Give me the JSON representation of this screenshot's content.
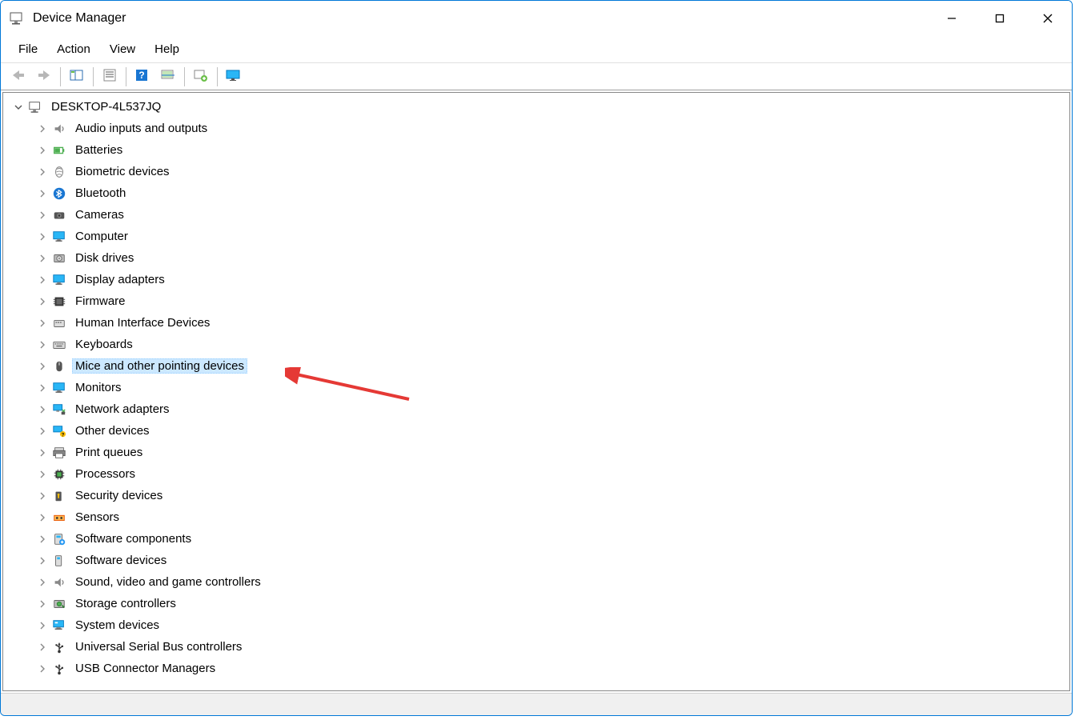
{
  "window": {
    "title": "Device Manager"
  },
  "menubar": {
    "items": [
      {
        "label": "File"
      },
      {
        "label": "Action"
      },
      {
        "label": "View"
      },
      {
        "label": "Help"
      }
    ]
  },
  "toolbar": {
    "buttons": [
      {
        "name": "back-button",
        "icon": "arrow-left-icon",
        "enabled": false
      },
      {
        "name": "forward-button",
        "icon": "arrow-right-icon",
        "enabled": false
      },
      {
        "sep": true
      },
      {
        "name": "show-hidden-button",
        "icon": "panel-icon"
      },
      {
        "sep": true
      },
      {
        "name": "properties-button",
        "icon": "properties-icon"
      },
      {
        "sep": true
      },
      {
        "name": "help-button",
        "icon": "help-icon"
      },
      {
        "name": "scan-hardware-button",
        "icon": "scan-icon"
      },
      {
        "sep": true
      },
      {
        "name": "add-legacy-button",
        "icon": "add-icon"
      },
      {
        "sep": true
      },
      {
        "name": "monitor-button",
        "icon": "monitor-icon"
      }
    ]
  },
  "tree": {
    "root_label": "DESKTOP-4L537JQ",
    "selected_index": 12,
    "categories": [
      {
        "label": "Audio inputs and outputs",
        "icon": "audio-icon"
      },
      {
        "label": "Batteries",
        "icon": "battery-icon"
      },
      {
        "label": "Biometric devices",
        "icon": "biometric-icon"
      },
      {
        "label": "Bluetooth",
        "icon": "bluetooth-icon"
      },
      {
        "label": "Cameras",
        "icon": "camera-icon"
      },
      {
        "label": "Computer",
        "icon": "computer-icon"
      },
      {
        "label": "Disk drives",
        "icon": "disk-icon"
      },
      {
        "label": "Display adapters",
        "icon": "display-icon"
      },
      {
        "label": "Firmware",
        "icon": "firmware-icon"
      },
      {
        "label": "Human Interface Devices",
        "icon": "hid-icon"
      },
      {
        "label": "Keyboards",
        "icon": "keyboard-icon"
      },
      {
        "label": "Mice and other pointing devices",
        "icon": "mouse-icon"
      },
      {
        "label": "Monitors",
        "icon": "monitor-icon"
      },
      {
        "label": "Network adapters",
        "icon": "network-icon"
      },
      {
        "label": "Other devices",
        "icon": "other-icon"
      },
      {
        "label": "Print queues",
        "icon": "printer-icon"
      },
      {
        "label": "Processors",
        "icon": "processor-icon"
      },
      {
        "label": "Security devices",
        "icon": "security-icon"
      },
      {
        "label": "Sensors",
        "icon": "sensor-icon"
      },
      {
        "label": "Software components",
        "icon": "software-comp-icon"
      },
      {
        "label": "Software devices",
        "icon": "software-dev-icon"
      },
      {
        "label": "Sound, video and game controllers",
        "icon": "sound-icon"
      },
      {
        "label": "Storage controllers",
        "icon": "storage-icon"
      },
      {
        "label": "System devices",
        "icon": "system-icon"
      },
      {
        "label": "Universal Serial Bus controllers",
        "icon": "usb-icon"
      },
      {
        "label": "USB Connector Managers",
        "icon": "usb-connector-icon"
      }
    ]
  },
  "annotation": {
    "arrow_target": "Mice and other pointing devices",
    "arrow_color": "#e53935"
  }
}
